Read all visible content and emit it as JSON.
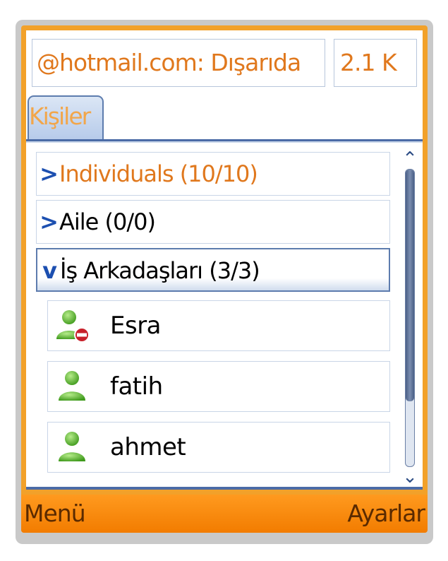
{
  "status": {
    "account_text": "@hotmail.com: Dışarıda",
    "data_size": "2.1 K"
  },
  "tabs": [
    {
      "label": "Kişiler"
    }
  ],
  "groups": [
    {
      "label": "Individuals (10/10)",
      "expanded": false
    },
    {
      "label": "Aile (0/0)",
      "expanded": false
    },
    {
      "label": "İş Arkadaşları (3/3)",
      "expanded": true
    }
  ],
  "chevrons": {
    "collapsed": ">",
    "expanded": "v"
  },
  "contacts": [
    {
      "name": "Esra",
      "icon": "user-busy-icon"
    },
    {
      "name": "fatih",
      "icon": "user-online-icon"
    },
    {
      "name": "ahmet",
      "icon": "user-online-icon"
    }
  ],
  "scroll": {
    "up_glyph": "⌃",
    "down_glyph": "⌄",
    "thumb_fraction": 0.78
  },
  "softkeys": {
    "left": "Menü",
    "right": "Ayarlar"
  },
  "colors": {
    "accent_orange": "#f2a12a",
    "softkey_orange": "#f27c00",
    "frame_blue": "#4b6ba6",
    "group_orange_text": "#e0781d"
  }
}
